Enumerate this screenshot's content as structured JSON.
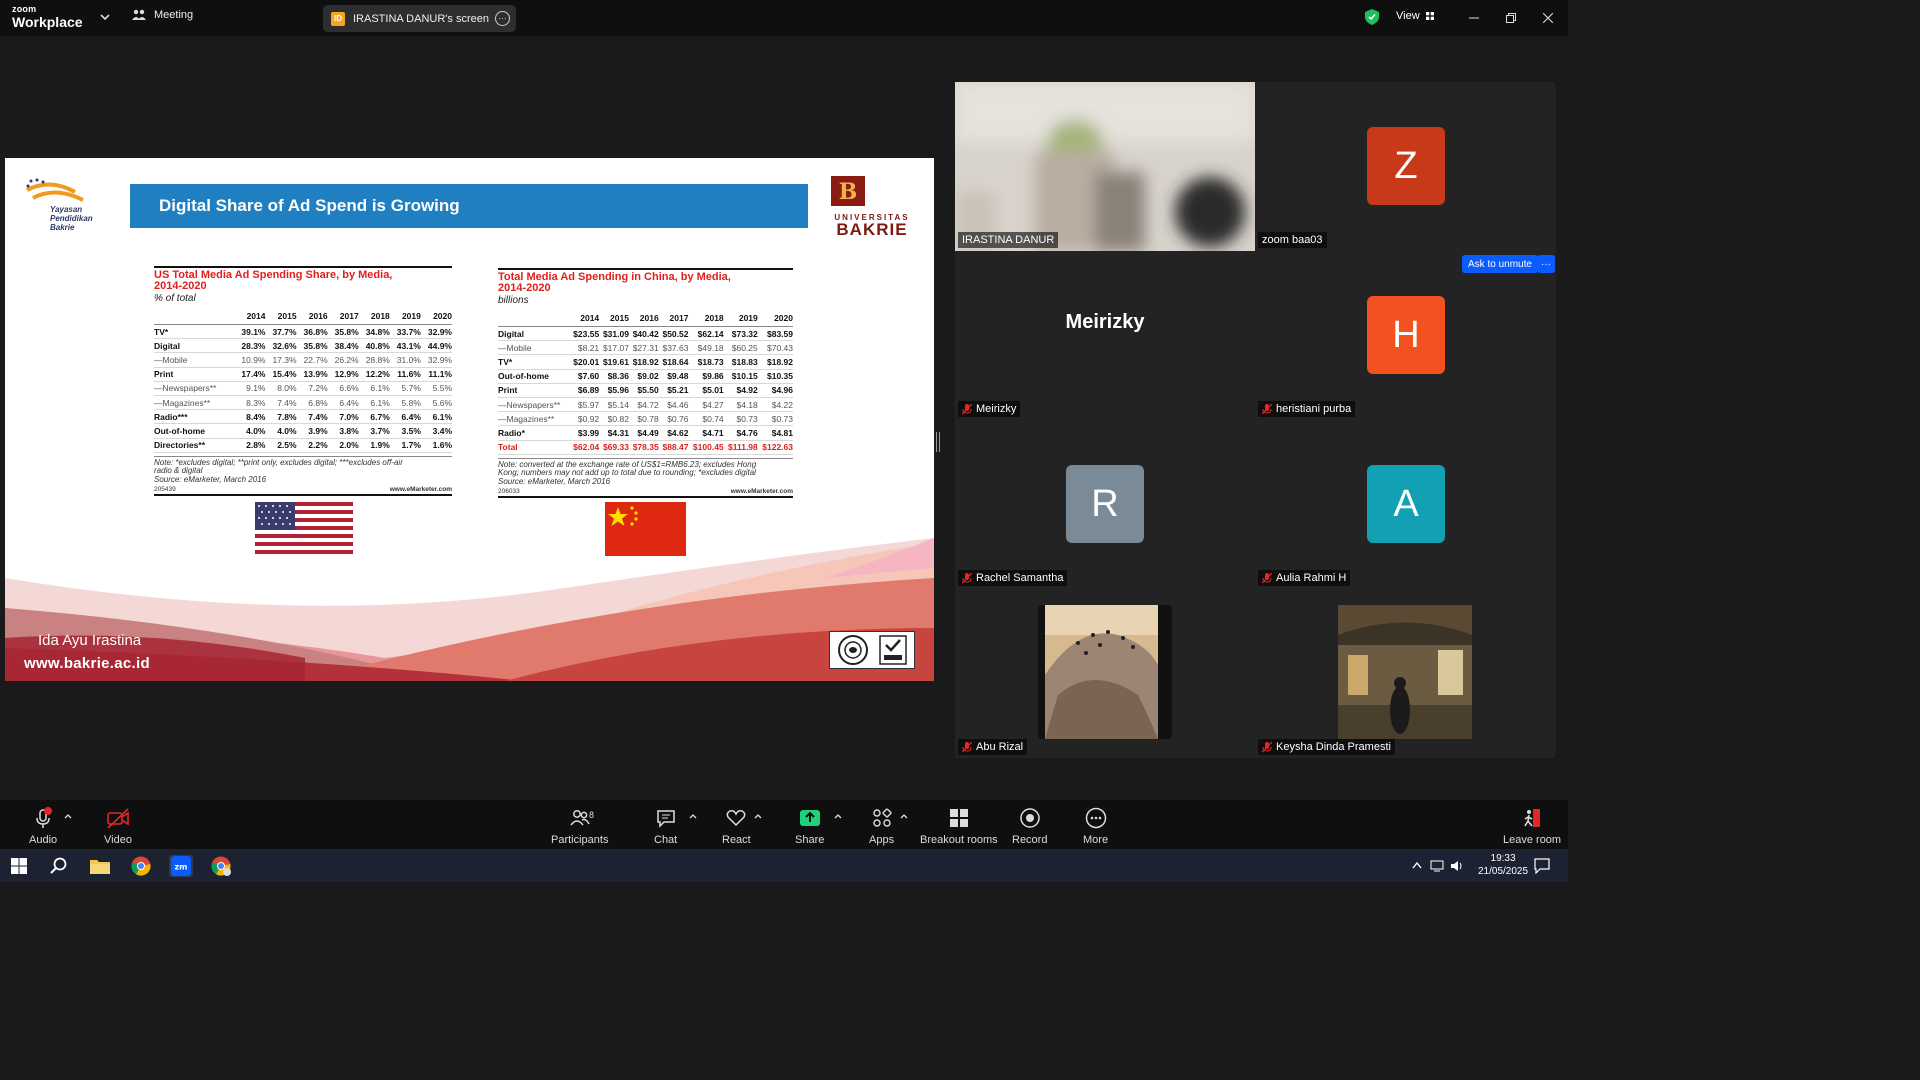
{
  "app": {
    "brand_top": "zoom",
    "brand_bottom": "Workplace",
    "meeting_label": "Meeting",
    "share_pill_badge": "ID",
    "share_pill_text": "IRASTINA DANUR's screen",
    "view_label": "View"
  },
  "slide": {
    "org_line1": "Yayasan",
    "org_line2": "Pendidikan",
    "org_line3": "Bakrie",
    "title": "Digital Share of Ad Spend is Growing",
    "univ_line1": "UNIVERSITAS",
    "univ_line2": "BAKRIE",
    "presenter": "Ida Ayu Irastina",
    "website": "www.bakrie.ac.id",
    "us_table": {
      "title_line1": "US Total Media Ad Spending Share, by Media,",
      "title_line2": "2014-2020",
      "unit": "% of total",
      "columns": [
        "",
        "2014",
        "2015",
        "2016",
        "2017",
        "2018",
        "2019",
        "2020"
      ],
      "rows": [
        [
          "TV*",
          "39.1%",
          "37.7%",
          "36.8%",
          "35.8%",
          "34.8%",
          "33.7%",
          "32.9%"
        ],
        [
          "Digital",
          "28.3%",
          "32.6%",
          "35.8%",
          "38.4%",
          "40.8%",
          "43.1%",
          "44.9%"
        ],
        [
          "—Mobile",
          "10.9%",
          "17.3%",
          "22.7%",
          "26.2%",
          "28.8%",
          "31.0%",
          "32.9%"
        ],
        [
          "Print",
          "17.4%",
          "15.4%",
          "13.9%",
          "12.9%",
          "12.2%",
          "11.6%",
          "11.1%"
        ],
        [
          "—Newspapers**",
          "9.1%",
          "8.0%",
          "7.2%",
          "6.6%",
          "6.1%",
          "5.7%",
          "5.5%"
        ],
        [
          "—Magazines**",
          "8.3%",
          "7.4%",
          "6.8%",
          "6.4%",
          "6.1%",
          "5.8%",
          "5.6%"
        ],
        [
          "Radio***",
          "8.4%",
          "7.8%",
          "7.4%",
          "7.0%",
          "6.7%",
          "6.4%",
          "6.1%"
        ],
        [
          "Out-of-home",
          "4.0%",
          "4.0%",
          "3.9%",
          "3.8%",
          "3.7%",
          "3.5%",
          "3.4%"
        ],
        [
          "Directories**",
          "2.8%",
          "2.5%",
          "2.2%",
          "2.0%",
          "1.9%",
          "1.7%",
          "1.6%"
        ]
      ],
      "row_styles": [
        "bold",
        "bold",
        "sub",
        "bold",
        "sub",
        "sub",
        "bold",
        "bold",
        "bold"
      ],
      "note_line1": "Note: *excludes digital; **print only, excludes digital; ***excludes off-air",
      "note_line2": "radio & digital",
      "note_line3": "Source: eMarketer, March 2016",
      "id": "205439",
      "site": "www.eMarketer.com"
    },
    "cn_table": {
      "title_line1": "Total Media Ad Spending in China, by Media,",
      "title_line2": "2014-2020",
      "unit": "billions",
      "columns": [
        "",
        "2014",
        "2015",
        "2016",
        "2017",
        "2018",
        "2019",
        "2020"
      ],
      "rows": [
        [
          "Digital",
          "$23.55",
          "$31.09",
          "$40.42",
          "$50.52",
          "$62.14",
          "$73.32",
          "$83.59"
        ],
        [
          "—Mobile",
          "$8.21",
          "$17.07",
          "$27.31",
          "$37.63",
          "$49.18",
          "$60.25",
          "$70.43"
        ],
        [
          "TV*",
          "$20.01",
          "$19.61",
          "$18.92",
          "$18.64",
          "$18.73",
          "$18.83",
          "$18.92"
        ],
        [
          "Out-of-home",
          "$7.60",
          "$8.36",
          "$9.02",
          "$9.48",
          "$9.86",
          "$10.15",
          "$10.35"
        ],
        [
          "Print",
          "$6.89",
          "$5.96",
          "$5.50",
          "$5.21",
          "$5.01",
          "$4.92",
          "$4.96"
        ],
        [
          "—Newspapers**",
          "$5.97",
          "$5.14",
          "$4.72",
          "$4.46",
          "$4.27",
          "$4.18",
          "$4.22"
        ],
        [
          "—Magazines**",
          "$0.92",
          "$0.82",
          "$0.78",
          "$0.76",
          "$0.74",
          "$0.73",
          "$0.73"
        ],
        [
          "Radio*",
          "$3.99",
          "$4.31",
          "$4.49",
          "$4.62",
          "$4.71",
          "$4.76",
          "$4.81"
        ],
        [
          "Total",
          "$62.04",
          "$69.33",
          "$78.35",
          "$88.47",
          "$100.45",
          "$111.98",
          "$122.63"
        ]
      ],
      "row_styles": [
        "bold",
        "sub",
        "bold",
        "bold",
        "bold",
        "sub",
        "sub",
        "bold",
        "total"
      ],
      "note_line1": "Note: converted at the exchange rate of US$1=RMB6.23; excludes Hong",
      "note_line2": "Kong; numbers may not add up to total due to rounding; *excludes digital",
      "note_line3": "Source: eMarketer, March 2016",
      "id": "206033",
      "site": "www.eMarketer.com"
    }
  },
  "gallery": {
    "tiles": [
      {
        "name": "IRASTINA DANUR"
      },
      {
        "name": "zoom baa03",
        "initial": "Z",
        "color": "#c8391a"
      },
      {
        "name": "Meirizky",
        "display": "Meirizky"
      },
      {
        "name": "heristiani purba",
        "initial": "H",
        "color": "#f2521f"
      },
      {
        "name": "Rachel Samantha",
        "initial": "R",
        "color": "#7a8b97"
      },
      {
        "name": "Aulia Rahmi H",
        "initial": "A",
        "color": "#12a0b3"
      },
      {
        "name": "Abu Rizal"
      },
      {
        "name": "Keysha Dinda Pramesti"
      }
    ],
    "ask_unmute": "Ask to unmute",
    "more": "···"
  },
  "toolbar": {
    "audio": "Audio",
    "video": "Video",
    "participants": "Participants",
    "participants_count": "8",
    "chat": "Chat",
    "react": "React",
    "share": "Share",
    "apps": "Apps",
    "breakout": "Breakout rooms",
    "record": "Record",
    "more": "More",
    "leave": "Leave room"
  },
  "taskbar": {
    "time": "19:33",
    "date": "21/05/2025"
  },
  "colors": {
    "accent_blue": "#0b5cff",
    "share_green": "#1fd17a",
    "active_outline": "#2bd96a",
    "slide_title_bg": "#1f7fc1",
    "table_red": "#e0201c"
  }
}
